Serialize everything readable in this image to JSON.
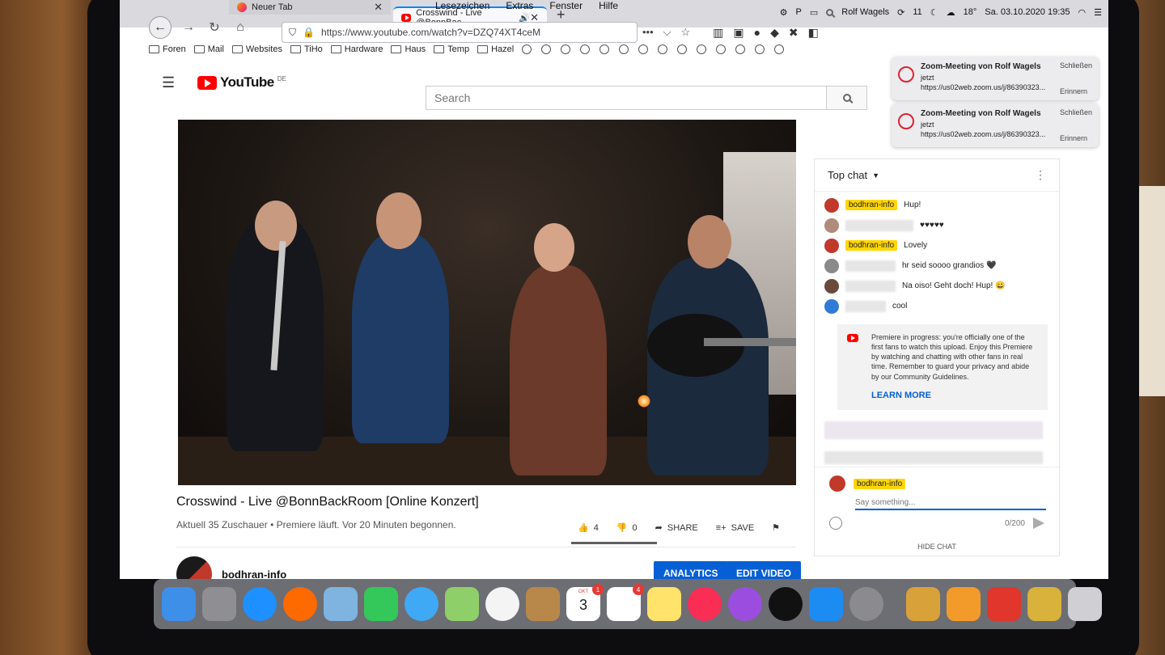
{
  "browser": {
    "tabs": [
      {
        "label": "Neuer Tab",
        "active": false
      },
      {
        "label": "Crosswind - Live @BonnBac",
        "active": true
      }
    ],
    "url": "https://www.youtube.com/watch?v=DZQ74XT4ceM",
    "mac_menu": [
      "Lesezeichen",
      "Extras",
      "Fenster",
      "Hilfe"
    ],
    "menubar": {
      "user": "Rolf Wagels",
      "updates": "11",
      "temperature": "18°",
      "datetime": "Sa. 03.10.2020 19:35"
    },
    "bookmarks": [
      "Foren",
      "Mail",
      "Websites",
      "TiHo",
      "Hardware",
      "Haus",
      "Temp",
      "Hazel"
    ]
  },
  "youtube": {
    "logo_text": "YouTube",
    "region": "DE",
    "search_placeholder": "Search",
    "video": {
      "title": "Crosswind - Live @BonnBackRoom [Online Konzert]",
      "meta": "Aktuell 35 Zuschauer • Premiere läuft. Vor 20 Minuten begonnen.",
      "likes": "4",
      "dislikes": "0",
      "like_ratio": 1.0,
      "share_label": "SHARE",
      "save_label": "SAVE"
    },
    "channel": {
      "name": "bodhran-info",
      "analytics_label": "ANALYTICS",
      "edit_label": "EDIT VIDEO"
    },
    "chat": {
      "header": "Top chat",
      "messages": [
        {
          "author": "bodhran-info",
          "owner": true,
          "text": "Hup!",
          "avatar_color": "#c0392b"
        },
        {
          "author": "",
          "owner": false,
          "text": "♥♥♥♥♥",
          "avatar_color": "#b08a7a"
        },
        {
          "author": "bodhran-info",
          "owner": true,
          "text": "Lovely",
          "avatar_color": "#c0392b"
        },
        {
          "author": "",
          "owner": false,
          "text": "hr seid soooo grandios 🖤",
          "avatar_color": "#8a8a8a"
        },
        {
          "author": "",
          "owner": false,
          "text": "Na oiso! Geht doch! Hup! 😄",
          "avatar_color": "#6a4a3a"
        },
        {
          "author": "",
          "owner": false,
          "text": "cool",
          "avatar_color": "#2f7bd6"
        }
      ],
      "premiere_text": "Premiere in progress: you're officially one of the first fans to watch this upload. Enjoy this Premiere by watching and chatting with other fans in real time. Remember to guard your privacy and abide by our Community Guidelines.",
      "learn_more": "LEARN MORE",
      "compose_author": "bodhran-info",
      "compose_placeholder": "Say something...",
      "counter": "0/200",
      "hide_chat": "HIDE CHAT"
    }
  },
  "notifications": [
    {
      "title": "Zoom-Meeting von Rolf Wagels",
      "time": "jetzt",
      "link": "https://us02web.zoom.us/j/86390323...",
      "close": "Schließen",
      "remind": "Erinnern"
    },
    {
      "title": "Zoom-Meeting von Rolf Wagels",
      "time": "jetzt",
      "link": "https://us02web.zoom.us/j/86390323...",
      "close": "Schließen",
      "remind": "Erinnern"
    }
  ],
  "dock": {
    "calendar_month": "OKT",
    "calendar_day": "3",
    "calendar_badge": "1",
    "reminders_badge": "4",
    "icons": [
      {
        "name": "finder-icon",
        "color": "#3d8fe8"
      },
      {
        "name": "launchpad-icon",
        "color": "#8e8e93"
      },
      {
        "name": "safari-icon",
        "color": "#1e90ff"
      },
      {
        "name": "firefox-icon",
        "color": "#ff6a00"
      },
      {
        "name": "mail-stamp-icon",
        "color": "#7fb3e0"
      },
      {
        "name": "facetime-icon",
        "color": "#34c759"
      },
      {
        "name": "messages-icon",
        "color": "#3fa9f5"
      },
      {
        "name": "maps-icon",
        "color": "#8fcf6a"
      },
      {
        "name": "photos-icon",
        "color": "#f4f4f4"
      },
      {
        "name": "contacts-icon",
        "color": "#b8884a"
      },
      {
        "name": "calendar-icon",
        "color": "#ffffff"
      },
      {
        "name": "reminders-icon",
        "color": "#ffffff"
      },
      {
        "name": "notes-icon",
        "color": "#ffe36b"
      },
      {
        "name": "music-icon",
        "color": "#fa2d55"
      },
      {
        "name": "podcasts-icon",
        "color": "#9b4de0"
      },
      {
        "name": "appletv-icon",
        "color": "#111111"
      },
      {
        "name": "appstore-icon",
        "color": "#1c8cf2"
      },
      {
        "name": "system-preferences-icon",
        "color": "#8a8a8f"
      },
      {
        "name": "basket-icon",
        "color": "#d9a13a"
      },
      {
        "name": "tweaking-app-icon",
        "color": "#f29b2a"
      },
      {
        "name": "remote-app-icon",
        "color": "#e0362c"
      },
      {
        "name": "archive-utility-icon",
        "color": "#d8b23a"
      },
      {
        "name": "trash-icon",
        "color": "#d0d0d4"
      }
    ]
  }
}
